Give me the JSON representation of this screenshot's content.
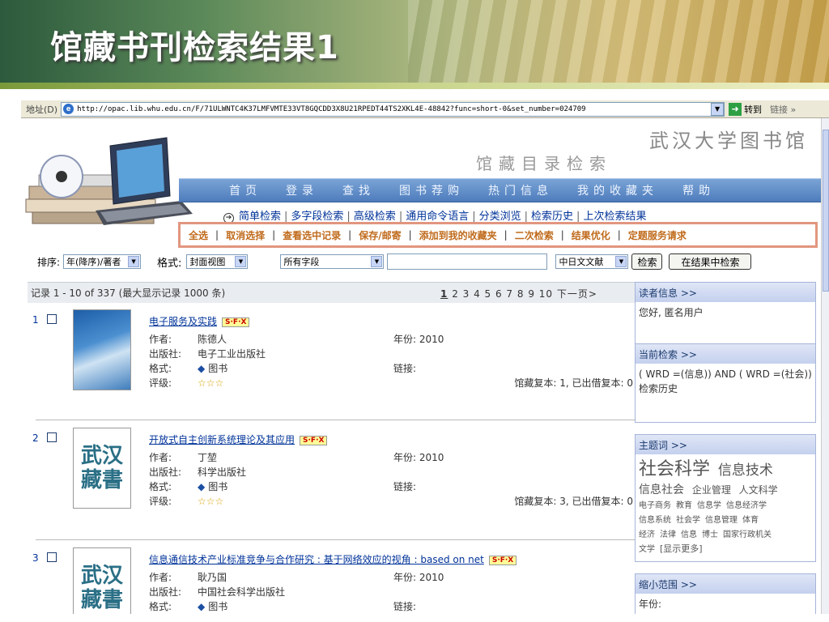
{
  "slide": {
    "title": "馆藏书刊检索结果1"
  },
  "browser": {
    "address_label": "地址(D)",
    "url": "http://opac.lib.whu.edu.cn/F/71ULWNTC4K37LMFVMTE33VT8GQCDD3X8U21RPEDT44TS2XKL4E-48842?func=short-0&set_number=024709",
    "go_label": "转到",
    "links_label": "链接 »"
  },
  "header": {
    "library_name": "武汉大学图书馆",
    "catalog_title": "馆藏目录检索"
  },
  "nav_main": [
    "首页",
    "登录",
    "查找",
    "图书荐购",
    "热门信息",
    "我的收藏夹",
    "帮助"
  ],
  "nav_sub": [
    "简单检索",
    "多字段检索",
    "高级检索",
    "通用命令语言",
    "分类浏览",
    "检索历史",
    "上次检索结果"
  ],
  "toolbar": [
    "全选",
    "取消选择",
    "查看选中记录",
    "保存/邮寄",
    "添加到我的收藏夹",
    "二次检索",
    "结果优化",
    "定题服务请求"
  ],
  "sortbar": {
    "sort_label": "排序:",
    "sort_value": "年(降序)/著者",
    "format_label": "格式:",
    "format_value": "封面视图",
    "field_value": "所有字段",
    "lang_value": "中日文文献",
    "search_btn": "检索",
    "within_btn": "在结果中检索"
  },
  "results": {
    "summary": "记录 1 - 10 of 337 (最大显示记录 1000 条)",
    "current_page": "1",
    "pages": "2 3 4 5 6 7 8 9 10",
    "next": "下一页>",
    "field_labels": {
      "author": "作者:",
      "publisher": "出版社:",
      "format": "格式:",
      "rating": "评级:",
      "year": "年份:",
      "link": "链接:"
    },
    "items": [
      {
        "num": "1",
        "title": "电子服务及实践",
        "author": "陈德人",
        "publisher": "电子工业出版社",
        "format": "图书",
        "rating": "☆☆☆",
        "year": "2010",
        "holdings": "馆藏复本: 1, 已出借复本: 0"
      },
      {
        "num": "2",
        "title": "开放式自主创新系统理论及其应用",
        "author": "丁堃",
        "publisher": "科学出版社",
        "format": "图书",
        "rating": "☆☆☆",
        "year": "2010",
        "holdings": "馆藏复本: 3, 已出借复本: 0"
      },
      {
        "num": "3",
        "title": "信息通信技术产业标准竞争与合作研究 : 基于网络效应的视角 : based on net",
        "author": "耿乃国",
        "publisher": "中国社会科学出版社",
        "format": "图书",
        "year": "2010"
      }
    ],
    "sfx_label": "S·F·X",
    "cover_logo": "武汉藏書"
  },
  "sidebar": {
    "reader_head": "读者信息 >>",
    "reader_body": "您好, 匿名用户",
    "query_head": "当前检索 >>",
    "query_body": "( WRD =(信息)) AND ( WRD =(社会))",
    "history_link": "检索历史",
    "subject_head": "主题词 >>",
    "subjects_big": [
      "社会科学",
      "信息技术"
    ],
    "subjects_mid": [
      "信息社会",
      "企业管理",
      "人文科学"
    ],
    "subjects_small": [
      "电子商务",
      "教育",
      "信息学",
      "信息经济学",
      "信息系统",
      "社会学",
      "信息管理",
      "体育",
      "经济",
      "法律",
      "信息",
      "博士",
      "国家行政机关",
      "文学",
      "[显示更多]"
    ],
    "narrow_head": "缩小范围 >>",
    "narrow_body": "年份:"
  }
}
